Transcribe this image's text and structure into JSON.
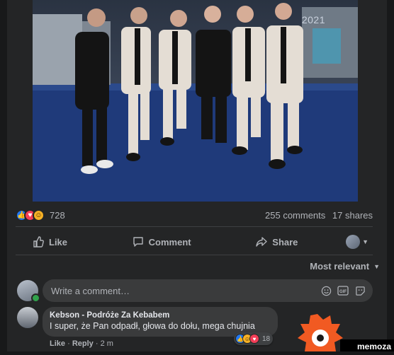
{
  "post": {
    "photo": {
      "overlay_text": "2021",
      "description_icon": "group-photo"
    },
    "stats": {
      "reaction_count": "728",
      "comments": "255 comments",
      "shares": "17 shares",
      "reactions": [
        "like",
        "love",
        "haha"
      ]
    },
    "actions": {
      "like_label": "Like",
      "comment_label": "Comment",
      "share_label": "Share"
    }
  },
  "comments_section": {
    "sort_label": "Most relevant",
    "write_placeholder": "Write a comment…",
    "comments": [
      {
        "author": "Kebson - Podróże Za Kebabem",
        "text": "I super, że Pan odpadł, głowa do dołu, mega chujnia",
        "like_label": "Like",
        "reply_label": "Reply",
        "time": "2 m",
        "reaction_count": "18"
      }
    ]
  },
  "watermark": {
    "text": "memoza"
  },
  "colors": {
    "background": "#18191a",
    "card": "#242526",
    "bubble": "#3a3b3c",
    "like_blue": "#2078f4",
    "love_red": "#f33e58",
    "haha_yellow": "#f7b125",
    "watermark_orange": "#f15a22"
  }
}
